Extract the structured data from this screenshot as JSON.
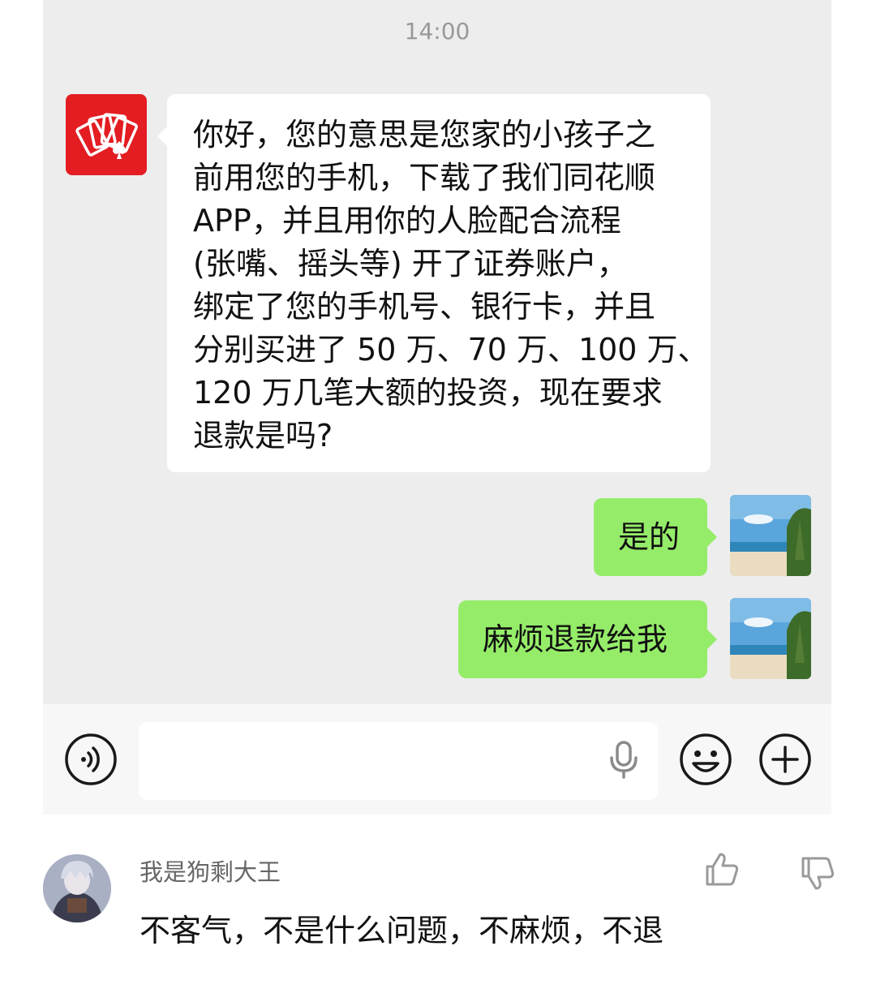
{
  "chat": {
    "timestamp": "14:00",
    "incoming_message_lines": [
      "你好，您的意思是您家的小孩子之",
      "前用您的手机，下载了我们同花顺",
      "APP，并且用你的人脸配合流程",
      "(张嘴、摇头等) 开了证券账户，",
      "绑定了您的手机号、银行卡，并且",
      "分别买进了 50 万、70 万、100 万、",
      "120 万几笔大额的投资，现在要求",
      "退款是吗?"
    ],
    "outgoing_messages": [
      "是的",
      "麻烦退款给我"
    ]
  },
  "input_bar": {
    "voice_icon": "voice-wave-icon",
    "mic_icon": "microphone-icon",
    "emoji_icon": "smiley-icon",
    "plus_icon": "plus-icon",
    "input_value": ""
  },
  "comment": {
    "username": "我是狗剩大王",
    "text": "不客气，不是什么问题，不麻烦，不退",
    "like_icon": "thumbs-up-icon",
    "dislike_icon": "thumbs-down-icon"
  },
  "colors": {
    "outgoing_bubble": "#95ec69",
    "app_avatar": "#e31d22",
    "chat_background": "#ededed"
  }
}
